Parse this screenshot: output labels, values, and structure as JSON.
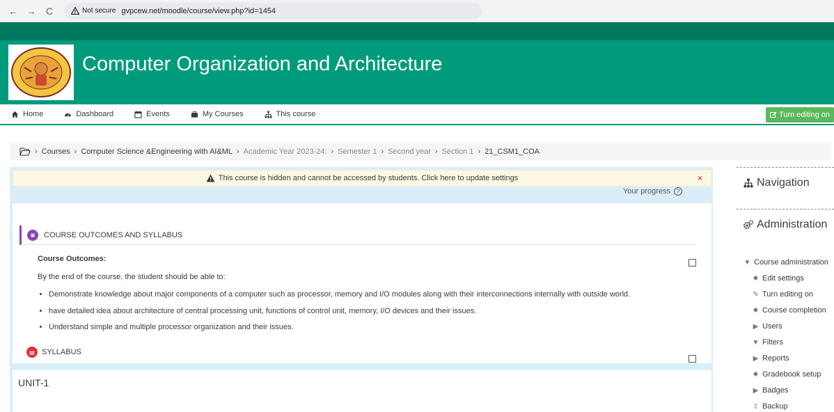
{
  "browser": {
    "back": "←",
    "forward": "→",
    "reload": "C",
    "not_secure": "Not secure",
    "url": "gvpcew.net/moodle/course/view.php?id=1454"
  },
  "header": {
    "title": "Computer Organization and Architecture",
    "logo_text": "GAYATRI VIDYA PARISHAD"
  },
  "nav": {
    "items": [
      "Home",
      "Dashboard",
      "Events",
      "My Courses",
      "This course"
    ],
    "edit_button": "Turn editing on"
  },
  "breadcrumb": [
    "Courses",
    "Computer Science &Engineering with AI&ML",
    "Academic Year 2023-24:",
    "Semester 1",
    "Second year",
    "Section 1",
    "21_CSM1_COA"
  ],
  "alert": {
    "text": "This course is hidden and cannot be accessed by students. Click here to update settings",
    "close": "×"
  },
  "progress_label": "Your progress",
  "section": {
    "activity_title": "COURSE OUTCOMES AND SYLLABUS",
    "co_title": "Course Outcomes:",
    "intro": "By the end of the course, the student should be able to:",
    "outcomes": [
      "Demonstrate knowledge about major components of a computer such as processor, memory and I/O modules along with their interconnections internally with outside world.",
      "have detailed idea about architecture of central processing unit, functions of control unit, memory, I/O devices and their issues.",
      "Understand simple and multiple processor organization and their issues."
    ],
    "syllabus": "SYLLABUS"
  },
  "unit": {
    "title": "UNIT-1"
  },
  "sidebar": {
    "navigation": "Navigation",
    "administration": "Administration",
    "admin_items": [
      "Course administration",
      "Edit settings",
      "Turn editing on",
      "Course completion",
      "Users",
      "Filters",
      "Reports",
      "Gradebook setup",
      "Badges",
      "Backup"
    ]
  },
  "colors": {
    "hero": "#009b7d",
    "strip": "#007a5e",
    "edit_button": "#5cb85c",
    "alert_bg": "#fcf8e3",
    "main_bg": "#daeef9"
  }
}
